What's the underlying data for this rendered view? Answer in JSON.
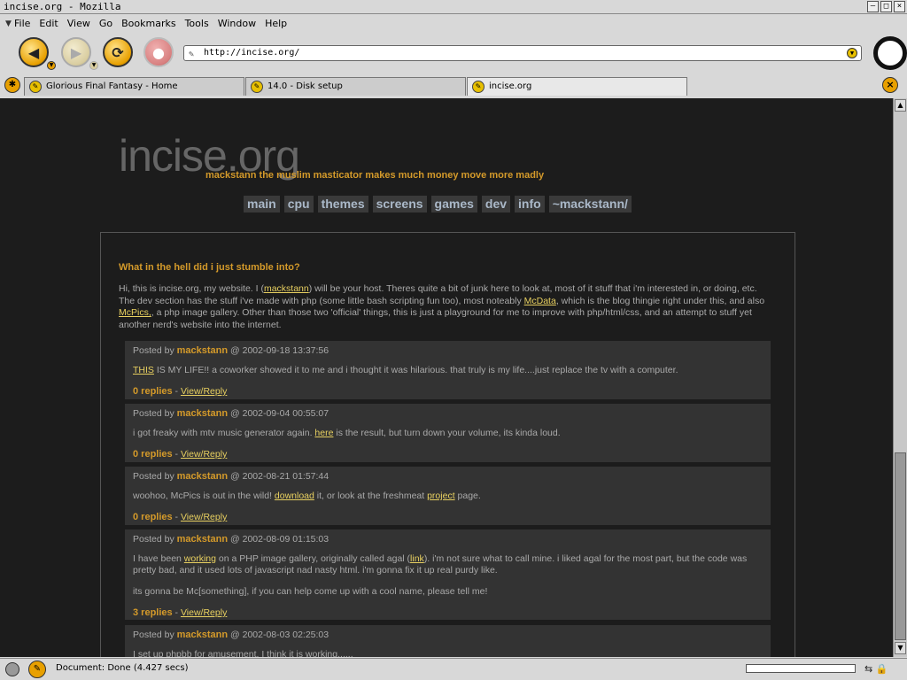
{
  "window": {
    "title": "incise.org - Mozilla"
  },
  "menu": [
    "File",
    "Edit",
    "View",
    "Go",
    "Bookmarks",
    "Tools",
    "Window",
    "Help"
  ],
  "toolbar": {
    "url": "http://incise.org/"
  },
  "tabs": [
    {
      "label": "Glorious Final Fantasy - Home"
    },
    {
      "label": "14.0 - Disk setup"
    },
    {
      "label": "incise.org"
    }
  ],
  "site": {
    "logo": "incise.org",
    "tagline": "mackstann the muslim masticator makes much money move more madly",
    "nav": [
      "main",
      "cpu",
      "themes",
      "screens",
      "games",
      "dev",
      "info",
      "~mackstann/"
    ],
    "headline": "What in the hell did i just stumble into?",
    "intro": {
      "t1": "Hi, this is incise.org, my website. I (",
      "l1": "mackstann",
      "t2": ") will be your host. Theres quite a bit of junk here to look at, most of it stuff that i'm interested in, or doing, etc. The dev section has the stuff i've made with php (some little bash scripting fun too), most noteably ",
      "l2": "McData",
      "t3": ", which is the blog thingie right under this, and also ",
      "l3": "McPics,",
      "t4": ", a php image gallery. Other than those two 'official' things, this is just a playground for me to improve with php/html/css, and an attempt to stuff yet another nerd's website into the internet."
    },
    "posted_by": "Posted by",
    "view_reply": "View/Reply",
    "posts": [
      {
        "author": "mackstann",
        "date": "@ 2002-09-18 13:37:56",
        "b_link": "THIS",
        "b_text": " IS MY LIFE!! a coworker showed it to me and i thought it was hilarious. that truly is my life....just replace the tv with a computer.",
        "replies": "0 replies"
      },
      {
        "author": "mackstann",
        "date": "@ 2002-09-04 00:55:07",
        "b_pre": "i got freaky with mtv music generator again. ",
        "b_link": "here",
        "b_text": " is the result, but turn down your volume, its kinda loud.",
        "replies": "0 replies"
      },
      {
        "author": "mackstann",
        "date": "@ 2002-08-21 01:57:44",
        "b_pre": "woohoo, McPics is out in the wild! ",
        "b_link": "download",
        "b_mid": " it, or look at the freshmeat ",
        "b_link2": "project",
        "b_text": " page.",
        "replies": "0 replies"
      },
      {
        "author": "mackstann",
        "date": "@ 2002-08-09 01:15:03",
        "b_pre": "I have been ",
        "b_link": "working",
        "b_mid": " on a PHP image gallery, originally called agal (",
        "b_link2": "link",
        "b_text": "). i'm not sure what to call mine. i liked agal for the most part, but the code was pretty bad, and it used lots of javascript nad nasty html. i'm gonna fix it up real purdy like.",
        "b_p2": "its gonna be Mc[something], if you can help come up with a cool name, please tell me!",
        "replies": "3 replies"
      },
      {
        "author": "mackstann",
        "date": "@ 2002-08-03 02:25:03",
        "b_pre": "I set up phpbb for amusement. I think it is working......"
      }
    ]
  },
  "status": {
    "text": "Document: Done (4.427 secs)"
  }
}
